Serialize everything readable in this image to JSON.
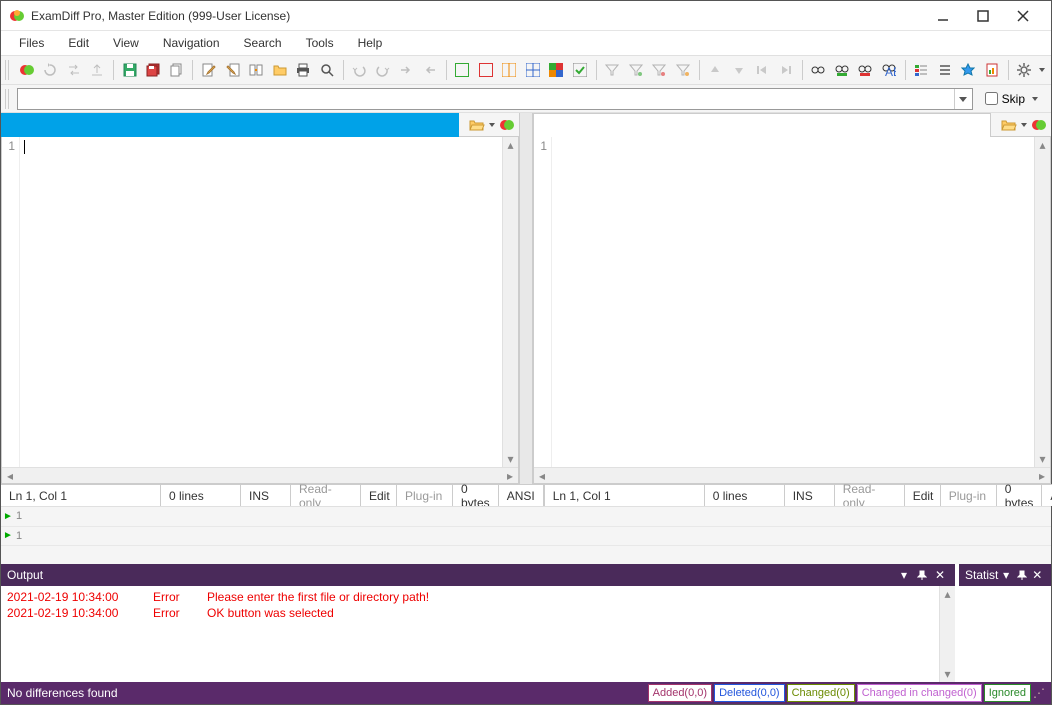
{
  "title": "ExamDiff Pro, Master Edition (999-User License)",
  "menu": {
    "files": "Files",
    "edit": "Edit",
    "view": "View",
    "navigation": "Navigation",
    "search": "Search",
    "tools": "Tools",
    "help": "Help"
  },
  "pathbar": {
    "skip_label": "Skip"
  },
  "pane_left": {
    "gutter_1": "1",
    "status": {
      "pos": "Ln 1, Col 1",
      "lines": "0 lines",
      "ins": "INS",
      "ro": "Read-only",
      "edit": "Edit",
      "plugin": "Plug-in",
      "size": "0 bytes",
      "enc": "ANSI"
    }
  },
  "pane_right": {
    "gutter_1": "1",
    "status": {
      "pos": "Ln 1, Col 1",
      "lines": "0 lines",
      "ins": "INS",
      "ro": "Read-only",
      "edit": "Edit",
      "plugin": "Plug-in",
      "size": "0 bytes",
      "enc": "ANSI"
    }
  },
  "minimap": {
    "r1": "1",
    "r2": "1"
  },
  "panels": {
    "output_title": "Output",
    "stat_title": "Statist",
    "rows": [
      {
        "ts": "2021-02-19 10:34:00",
        "lvl": "Error",
        "msg": "Please enter the first file or directory path!"
      },
      {
        "ts": "2021-02-19 10:34:00",
        "lvl": "Error",
        "msg": "OK button was selected"
      }
    ]
  },
  "statusbar": {
    "main": "No differences found",
    "added": "Added(0,0)",
    "deleted": "Deleted(0,0)",
    "changed": "Changed(0)",
    "chinch": "Changed in changed(0)",
    "ignored": "Ignored"
  }
}
